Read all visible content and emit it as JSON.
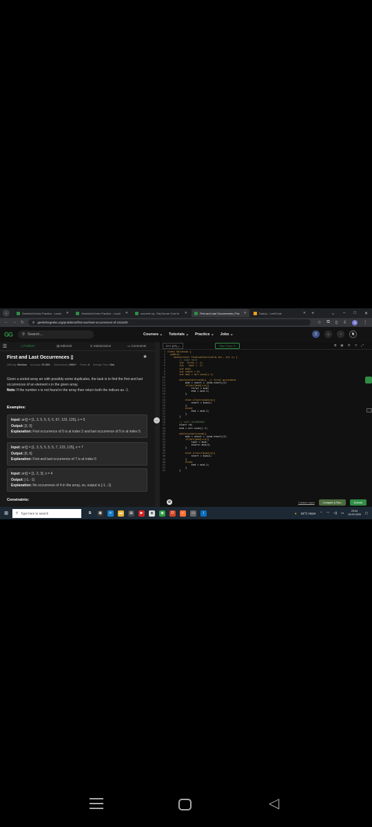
{
  "browser": {
    "tabs": [
      {
        "label": "GeeksforGeeks Practice - Leadi",
        "icon": "gfg-favicon",
        "active": false
      },
      {
        "label": "GeeksforGeeks Practice - Leadi",
        "icon": "gfg-favicon",
        "active": false
      },
      {
        "label": "navneet raj - Raj Kumar Goel In",
        "icon": "gfg-favicon",
        "active": false
      },
      {
        "label": "First and Last Occurrences | Pra",
        "icon": "gfg-favicon",
        "active": true
      },
      {
        "label": "Sqrt(x) - LeetCode",
        "icon": "leetcode-favicon",
        "active": false
      }
    ],
    "url": "geeksforgeeks.org/problems/first-and-last-occurrences-of-x3116/0",
    "profile_initial": "N"
  },
  "site_nav": {
    "logo": "GG",
    "search_placeholder": "Search...",
    "links": [
      "Courses",
      "Tutorials",
      "Practice",
      "Jobs"
    ],
    "user_initial": "N"
  },
  "problem_tabs": [
    "Problem",
    "Editorial",
    "Submissions",
    "Comments"
  ],
  "problem": {
    "title": "First and Last Occurrences",
    "meta": {
      "difficulty_label": "Difficulty:",
      "difficulty": "Medium",
      "accuracy_label": "Accuracy:",
      "accuracy": "37.36%",
      "submissions_label": "Submissions:",
      "submissions": "290K+",
      "points_label": "Points:",
      "points": "4",
      "avg_time_label": "Average Time:",
      "avg_time": "15m"
    },
    "description_1": "Given a sorted array arr with possibly some duplicates, the task is to find the first and last occurrences of an element x in the given array.",
    "note_label": "Note:",
    "note": "If the number x is not found in the array then return both the indices as -1.",
    "examples_heading": "Examples:",
    "examples": [
      {
        "input": "arr[] = [1, 3, 5, 5, 5, 5, 67, 123, 125], x = 5",
        "output": "[2, 5]",
        "explanation": "First occurrence of 5 is at index 2 and last occurrence of 5 is at index 5"
      },
      {
        "input": "arr[] = [1, 3, 5, 5, 5, 5, 7, 123, 125], x = 7",
        "output": "[6, 6]",
        "explanation": "First and last occurrence of 7 is at index 6"
      },
      {
        "input": "arr[] = [1, 2, 3], x = 4",
        "output": "[-1, -1]",
        "explanation": "No occurrence of 4 in the array, so, output is [-1, -1]"
      }
    ],
    "labels": {
      "input": "Input:",
      "output": "Output:",
      "explanation": "Explanation:"
    },
    "constraints_heading": "Constraints:"
  },
  "editor": {
    "language": "C++ (17)",
    "timer_label": "Start Timer",
    "lines": [
      "class Solution {",
      "  public:",
      "    vector<int> find(vector<int>& arr, int x) {",
      "        // code here",
      "        int  first = -1;",
      "        int   last = -1;",
      "        int mid;",
      "        int start = 0;",
      "        int end = arr.size()-1;",
      "",
      "        while(start<=end){  // first occurence",
      "            mid = start + (end-start)/2;",
      "            if(arr[mid]==x){",
      "                first = mid;",
      "                end = mid-1;",
      "            }",
      "",
      "            else if(arr[mid]<x){",
      "                start = mid+1;",
      "            }",
      "            else{",
      "                end = mid-1;",
      "            }",
      "        }",
      "",
      "        // LAST OCCURENCE",
      "        start =0;",
      "        end = arr.size()-1;",
      "",
      "        while(start<=end){",
      "            mid = start + (end-start)/2;",
      "            if(arr[mid]==x){",
      "                last = mid;",
      "                start= mid+1;",
      "            }",
      "",
      "            else if(arr[mid]<x){",
      "                start = mid+1;",
      "            }",
      "            else{",
      "                end = mid-1;",
      "            }",
      "        }"
    ],
    "custom_input_label": "Custom Input",
    "compile_label": "Compile & Run",
    "submit_label": "Submit"
  },
  "taskbar": {
    "search_placeholder": "Type here to search",
    "weather": "34°C  Haze",
    "time": "23:34",
    "date": "26-09-2025"
  }
}
